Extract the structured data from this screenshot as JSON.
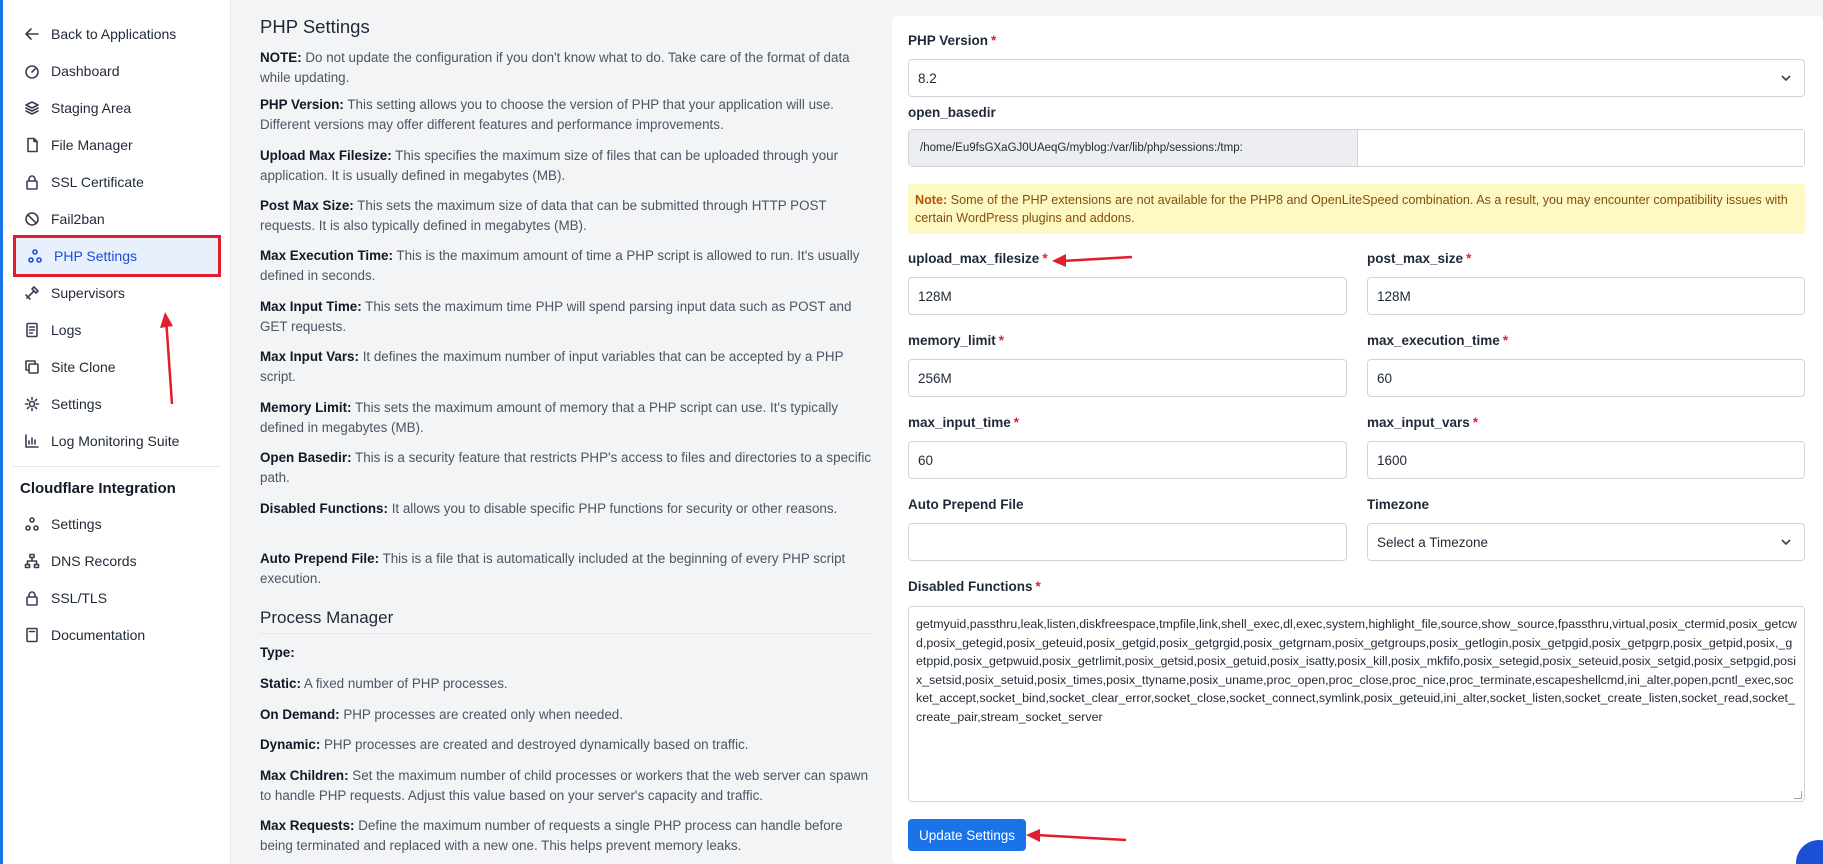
{
  "sidebar": {
    "items": [
      {
        "label": "Back to Applications",
        "icon": "arrow-left-icon"
      },
      {
        "label": "Dashboard",
        "icon": "gauge-icon"
      },
      {
        "label": "Staging Area",
        "icon": "layers-icon"
      },
      {
        "label": "File Manager",
        "icon": "file-icon"
      },
      {
        "label": "SSL Certificate",
        "icon": "lock-icon"
      },
      {
        "label": "Fail2ban",
        "icon": "ban-icon"
      },
      {
        "label": "PHP Settings",
        "icon": "nodes-icon"
      },
      {
        "label": "Supervisors",
        "icon": "tools-icon"
      },
      {
        "label": "Logs",
        "icon": "document-icon"
      },
      {
        "label": "Site Clone",
        "icon": "copy-icon"
      },
      {
        "label": "Settings",
        "icon": "gear-icon"
      },
      {
        "label": "Log Monitoring Suite",
        "icon": "chart-icon"
      }
    ],
    "active": "PHP Settings",
    "cloudflare_heading": "Cloudflare Integration",
    "cloudflare_items": [
      {
        "label": "Settings",
        "icon": "nodes-icon"
      },
      {
        "label": "DNS Records",
        "icon": "sitemap-icon"
      },
      {
        "label": "SSL/TLS",
        "icon": "lock-icon"
      },
      {
        "label": "Documentation",
        "icon": "book-icon"
      }
    ]
  },
  "description": {
    "title": "PHP Settings",
    "paragraphs": [
      {
        "term": "NOTE:",
        "text": " Do not update the configuration if you don't know what to do. Take care of the format of data while updating."
      },
      {
        "term": "PHP Version:",
        "text": " This setting allows you to choose the version of PHP that your application will use. Different versions may offer different features and performance improvements."
      },
      {
        "term": "Upload Max Filesize:",
        "text": " This specifies the maximum size of files that can be uploaded through your application. It is usually defined in megabytes (MB)."
      },
      {
        "term": "Post Max Size:",
        "text": " This sets the maximum size of data that can be submitted through HTTP POST requests. It is also typically defined in megabytes (MB)."
      },
      {
        "term": "Max Execution Time:",
        "text": " This is the maximum amount of time a PHP script is allowed to run. It's usually defined in seconds."
      },
      {
        "term": "Max Input Time:",
        "text": " This sets the maximum time PHP will spend parsing input data such as POST and GET requests."
      },
      {
        "term": "Max Input Vars:",
        "text": " It defines the maximum number of input variables that can be accepted by a PHP script."
      },
      {
        "term": "Memory Limit:",
        "text": " This sets the maximum amount of memory that a PHP script can use. It's typically defined in megabytes (MB)."
      },
      {
        "term": "Open Basedir:",
        "text": " This is a security feature that restricts PHP's access to files and directories to a specific path."
      },
      {
        "term": "Disabled Functions:",
        "text": " It allows you to disable specific PHP functions for security or other reasons."
      },
      {
        "term": "Auto Prepend File:",
        "text": " This is a file that is automatically included at the beginning of every PHP script execution."
      }
    ],
    "pm_title": "Process Manager",
    "pm_paragraphs": [
      {
        "term": "Type:",
        "text": ""
      },
      {
        "term": "Static:",
        "text": " A fixed number of PHP processes."
      },
      {
        "term": "On Demand:",
        "text": " PHP processes are created only when needed."
      },
      {
        "term": "Dynamic:",
        "text": " PHP processes are created and destroyed dynamically based on traffic."
      },
      {
        "term": "Max Children:",
        "text": " Set the maximum number of child processes or workers that the web server can spawn to handle PHP requests. Adjust this value based on your server's capacity and traffic."
      },
      {
        "term": "Max Requests:",
        "text": " Define the maximum number of requests a single PHP process can handle before being terminated and replaced with a new one. This helps prevent memory leaks."
      }
    ]
  },
  "form": {
    "php_version": {
      "label": "PHP Version",
      "value": "8.2"
    },
    "open_basedir": {
      "label": "open_basedir",
      "value": "/home/Eu9fsGXaGJ0UAeqG/myblog:/var/lib/php/sessions:/tmp:",
      "extra_value": ""
    },
    "note": {
      "term": "Note:",
      "text": " Some of the PHP extensions are not available for the PHP8 and OpenLiteSpeed combination. As a result, you may encounter compatibility issues with certain WordPress plugins and addons."
    },
    "upload_max_filesize": {
      "label": "upload_max_filesize",
      "value": "128M"
    },
    "post_max_size": {
      "label": "post_max_size",
      "value": "128M"
    },
    "memory_limit": {
      "label": "memory_limit",
      "value": "256M"
    },
    "max_execution_time": {
      "label": "max_execution_time",
      "value": "60"
    },
    "max_input_time": {
      "label": "max_input_time",
      "value": "60"
    },
    "max_input_vars": {
      "label": "max_input_vars",
      "value": "1600"
    },
    "auto_prepend_file": {
      "label": "Auto Prepend File",
      "value": ""
    },
    "timezone": {
      "label": "Timezone",
      "value": "Select a Timezone"
    },
    "disabled_functions": {
      "label": "Disabled Functions",
      "value": "getmyuid,passthru,leak,listen,diskfreespace,tmpfile,link,shell_exec,dl,exec,system,highlight_file,source,show_source,fpassthru,virtual,posix_ctermid,posix_getcwd,posix_getegid,posix_geteuid,posix_getgid,posix_getgrgid,posix_getgrnam,posix_getgroups,posix_getlogin,posix_getpgid,posix_getpgrp,posix_getpid,posix,_getppid,posix_getpwuid,posix_getrlimit,posix_getsid,posix_getuid,posix_isatty,posix_kill,posix_mkfifo,posix_setegid,posix_seteuid,posix_setgid,posix_setpgid,posix_setsid,posix_setuid,posix_times,posix_ttyname,posix_uname,proc_open,proc_close,proc_nice,proc_terminate,escapeshellcmd,ini_alter,popen,pcntl_exec,socket_accept,socket_bind,socket_clear_error,socket_close,socket_connect,symlink,posix_geteuid,ini_alter,socket_listen,socket_create_listen,socket_read,socket_create_pair,stream_socket_server"
    },
    "required_marker": "*",
    "submit_label": "Update Settings"
  },
  "colors": {
    "accent": "#1a73e8",
    "required": "#e11d2e",
    "annotation": "#e11d2e",
    "note_bg": "#fef9c3"
  }
}
